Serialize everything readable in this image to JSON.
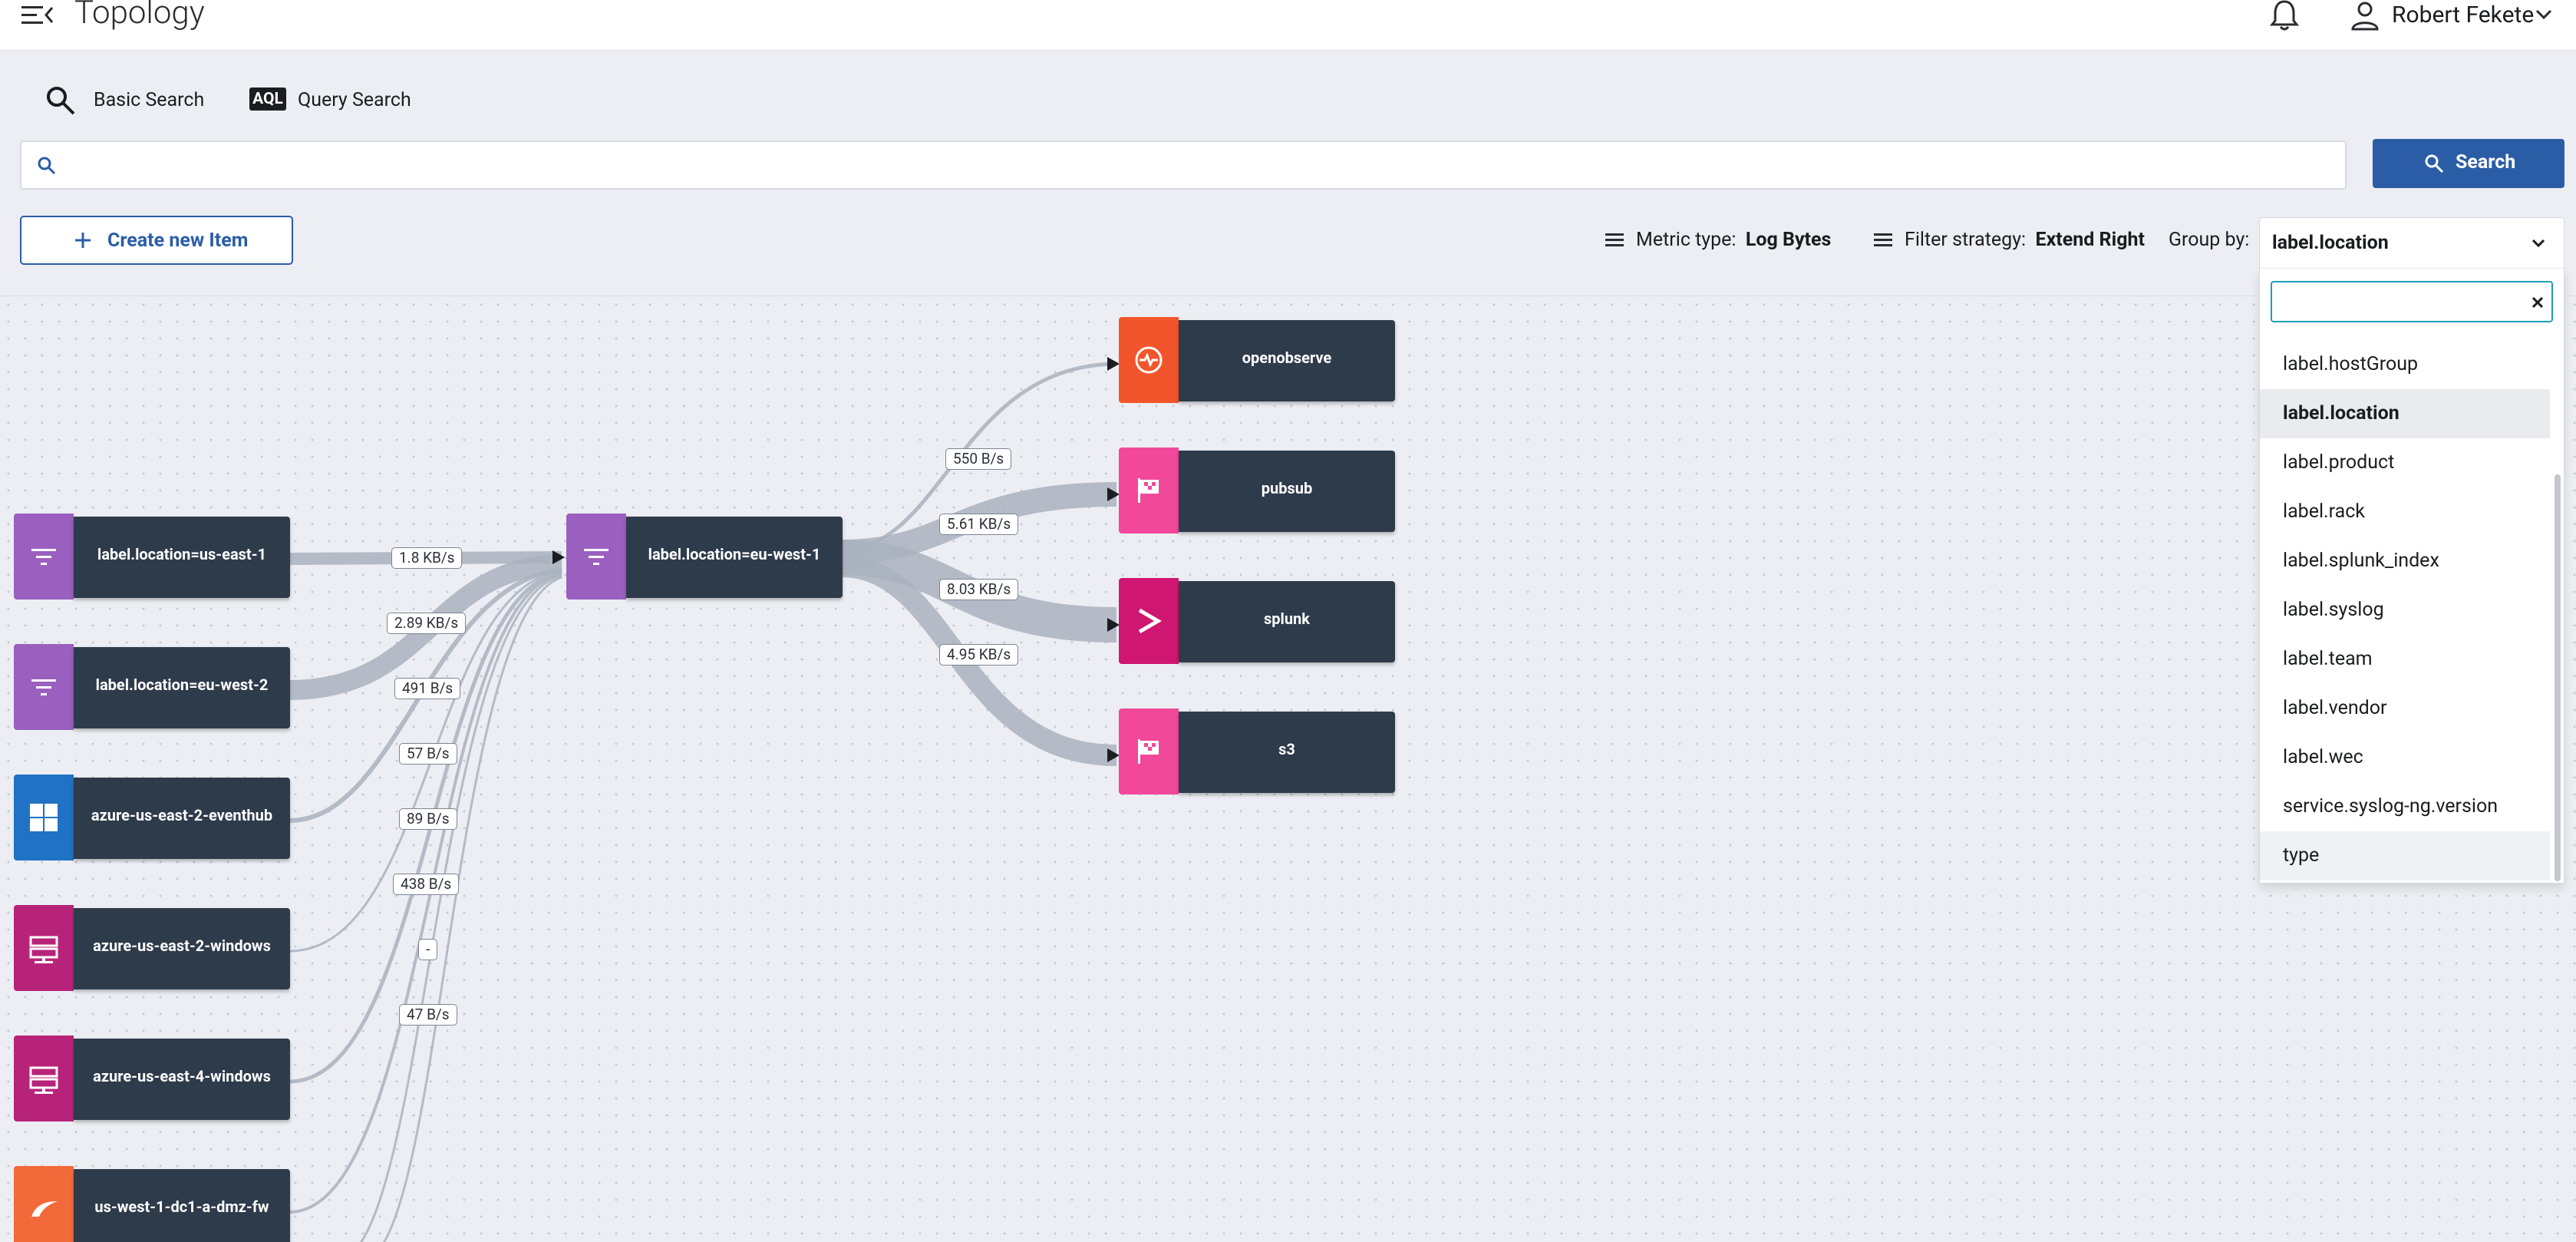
{
  "header": {
    "title": "Topology",
    "user_name": "Robert Fekete"
  },
  "tabs": [
    {
      "label": "Basic Search"
    },
    {
      "label": "Query Search",
      "badge": "AQL"
    }
  ],
  "search": {
    "value": "",
    "placeholder": "",
    "button_label": "Search"
  },
  "toolbar": {
    "create_label": "Create new Item",
    "metric_type_label": "Metric type:",
    "metric_type_value": "Log Bytes",
    "filter_strategy_label": "Filter strategy:",
    "filter_strategy_value": "Extend Right",
    "group_by_label": "Group by:",
    "group_by_value": "label.location"
  },
  "dropdown": {
    "search_value": "",
    "options": [
      "label.hostGroup",
      "label.location",
      "label.product",
      "label.rack",
      "label.splunk_index",
      "label.syslog",
      "label.team",
      "label.vendor",
      "label.wec",
      "service.syslog-ng.version",
      "type"
    ],
    "selected": "label.location"
  },
  "topology": {
    "sources": [
      {
        "label": "label.location=us-east-1",
        "icon": "filter-icon",
        "color": "#9b5fc0"
      },
      {
        "label": "label.location=eu-west-2",
        "icon": "filter-icon",
        "color": "#9b5fc0"
      },
      {
        "label": "azure-us-east-2-eventhub",
        "icon": "windows-icon",
        "color": "#1f72c4"
      },
      {
        "label": "azure-us-east-2-windows",
        "icon": "server-icon",
        "color": "#b8237a"
      },
      {
        "label": "azure-us-east-4-windows",
        "icon": "server-icon",
        "color": "#b8237a"
      },
      {
        "label": "us-west-1-dc1-a-dmz-fw",
        "icon": "firewall-icon",
        "color": "#f26a3a"
      }
    ],
    "hub": {
      "label": "label.location=eu-west-1",
      "icon": "filter-icon",
      "color": "#9b5fc0"
    },
    "destinations": [
      {
        "label": "openobserve",
        "icon": "pulse-icon",
        "color": "#f2552c"
      },
      {
        "label": "pubsub",
        "icon": "flag-icon",
        "color": "#f2489a"
      },
      {
        "label": "splunk",
        "icon": "chevron-right-icon",
        "color": "#cf1670"
      },
      {
        "label": "s3",
        "icon": "flag-icon",
        "color": "#f2489a"
      }
    ],
    "in_edges": [
      "1.8 KB/s",
      "2.89 KB/s",
      "491 B/s",
      "57 B/s",
      "89 B/s",
      "438 B/s",
      "-",
      "47 B/s"
    ],
    "out_edges": [
      "550 B/s",
      "5.61 KB/s",
      "8.03 KB/s",
      "4.95 KB/s"
    ]
  }
}
